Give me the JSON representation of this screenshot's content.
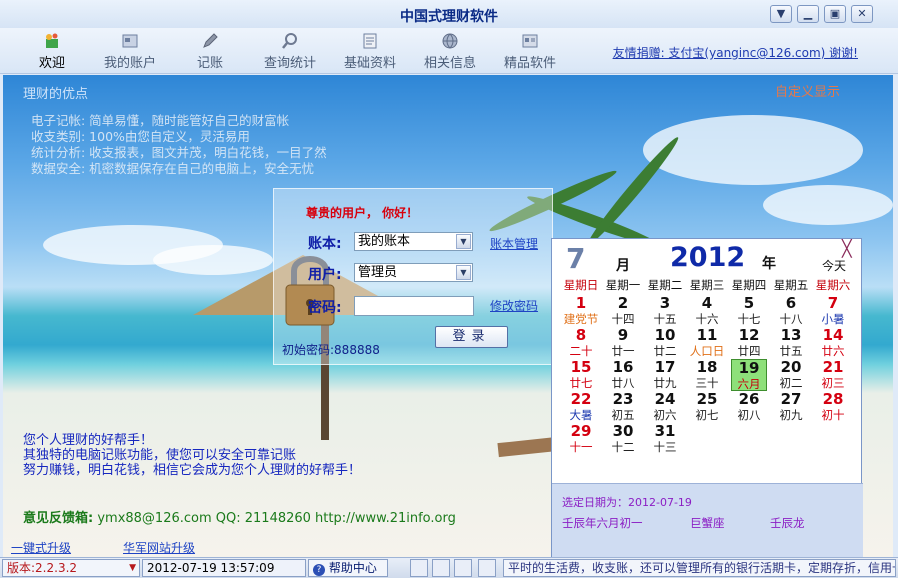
{
  "window": {
    "title": "中国式理财软件",
    "buttons": [
      "minimize",
      "restore",
      "close"
    ]
  },
  "toolbar": {
    "items": [
      {
        "label": "欢迎",
        "icon": "welcome-icon",
        "active": true
      },
      {
        "label": "我的账户",
        "icon": "account-icon",
        "active": false
      },
      {
        "label": "记账",
        "icon": "pen-icon",
        "active": false
      },
      {
        "label": "查询统计",
        "icon": "magnifier-icon",
        "active": false
      },
      {
        "label": "基础资料",
        "icon": "document-icon",
        "active": false
      },
      {
        "label": "相关信息",
        "icon": "globe-icon",
        "active": false
      },
      {
        "label": "精品软件",
        "icon": "software-icon",
        "active": false
      }
    ],
    "donate": "友情捐赠: 支付宝(yanginc@126.com) 谢谢!"
  },
  "advantages": {
    "title": "理财的优点",
    "lines": [
      "电子记帐:  简单易懂，随时能管好自己的财富帐",
      "收支类别:  100%由您自定义，灵活易用",
      "统计分析:  收支报表，图文并茂，明白花钱，一目了然",
      "数据安全:  机密数据保存在自己的电脑上，安全无忧"
    ]
  },
  "custom_display": "自定义显示",
  "login": {
    "greeting": "尊贵的用户， 你好！",
    "book_label": "账本:",
    "book_value": "我的账本",
    "book_manage": "账本管理",
    "user_label": "用户:",
    "user_value": "管理员",
    "password_label": "密码:",
    "password_value": "",
    "change_password": "修改密码",
    "login_button": "登录",
    "initial_password": "初始密码:888888"
  },
  "calendar": {
    "month": "7",
    "month_label": "月",
    "year": "2012",
    "year_label": "年",
    "today_label": "今天",
    "weekdays": [
      "星期日",
      "星期一",
      "星期二",
      "星期三",
      "星期四",
      "星期五",
      "星期六"
    ],
    "weeks": [
      [
        {
          "d": "1",
          "l": "建党节"
        },
        {
          "d": "2",
          "l": "十四"
        },
        {
          "d": "3",
          "l": "十五"
        },
        {
          "d": "4",
          "l": "十六"
        },
        {
          "d": "5",
          "l": "十七"
        },
        {
          "d": "6",
          "l": "十八"
        },
        {
          "d": "7",
          "l": "小暑"
        }
      ],
      [
        {
          "d": "8",
          "l": "二十"
        },
        {
          "d": "9",
          "l": "廿一"
        },
        {
          "d": "10",
          "l": "廿二"
        },
        {
          "d": "11",
          "l": "人口日"
        },
        {
          "d": "12",
          "l": "廿四"
        },
        {
          "d": "13",
          "l": "廿五"
        },
        {
          "d": "14",
          "l": "廿六"
        }
      ],
      [
        {
          "d": "15",
          "l": "廿七"
        },
        {
          "d": "16",
          "l": "廿八"
        },
        {
          "d": "17",
          "l": "廿九"
        },
        {
          "d": "18",
          "l": "三十"
        },
        {
          "d": "19",
          "l": "六月"
        },
        {
          "d": "20",
          "l": "初二"
        },
        {
          "d": "21",
          "l": "初三"
        }
      ],
      [
        {
          "d": "22",
          "l": "大暑"
        },
        {
          "d": "23",
          "l": "初五"
        },
        {
          "d": "24",
          "l": "初六"
        },
        {
          "d": "25",
          "l": "初七"
        },
        {
          "d": "26",
          "l": "初八"
        },
        {
          "d": "27",
          "l": "初九"
        },
        {
          "d": "28",
          "l": "初十"
        }
      ],
      [
        {
          "d": "29",
          "l": "十一"
        },
        {
          "d": "30",
          "l": "十二"
        },
        {
          "d": "31",
          "l": "十三"
        }
      ]
    ],
    "selected_label": "选定日期为：2012-07-19",
    "lunar_date": "壬辰年六月初一",
    "constellation": "巨蟹座",
    "zodiac": "壬辰龙",
    "close_glyph": "╳"
  },
  "helper_text": [
    "您个人理财的好帮手！",
    "其独特的电脑记账功能，使您可以安全可靠记账",
    "努力赚钱，明白花钱，相信它会成为您个人理财的好帮手！"
  ],
  "feedback": {
    "label": "意见反馈箱:",
    "value": "ymx88@126.com QQ: 21148260  http://www.21info.org"
  },
  "bottom_links": [
    "一键式升级",
    "华军网站升级"
  ],
  "statusbar": {
    "version": "版本:2.2.3.2",
    "datetime": "2012-07-19 13:57:09",
    "help": "帮助中心",
    "ticker": "平时的生活费，收支账，还可以管理所有的银行活期卡，定期存折，信用卡"
  },
  "colors": {
    "accent": "#0b2b86",
    "weekend_red": "#d40010",
    "today_green": "#8ee07a",
    "lunar_purple": "#8b1ec4"
  }
}
